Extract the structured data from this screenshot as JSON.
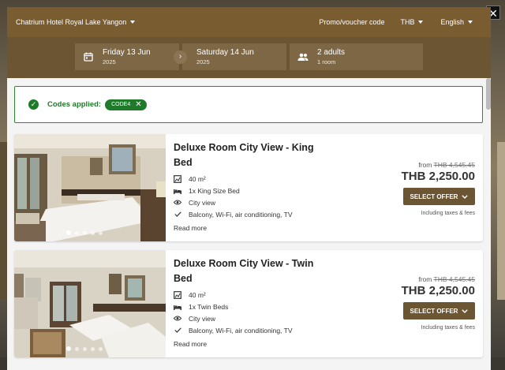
{
  "header": {
    "hotel_name": "Chatrium Hotel Royal Lake Yangon",
    "promo_label": "Promo/voucher code",
    "currency": "THB",
    "language": "English",
    "close_glyph": "✕"
  },
  "search": {
    "checkin_date": "Friday 13 Jun",
    "checkin_year": "2025",
    "checkout_date": "Saturday 14 Jun",
    "checkout_year": "2025",
    "guests": "2 adults",
    "rooms": "1 room"
  },
  "codes": {
    "label": "Codes applied:",
    "code": "CODE4"
  },
  "rooms": [
    {
      "title_line1": "Deluxe Room City View - King",
      "title_line2": "Bed",
      "size": "40 m²",
      "bed": "1x King Size Bed",
      "view": "City view",
      "amenities": "Balcony, Wi-Fi, air conditioning, TV",
      "read_more": "Read more",
      "from_label": "from",
      "old_price": "THB 4,545.45",
      "price": "THB 2,250.00",
      "select_label": "SELECT OFFER",
      "tax_note": "Including taxes & fees"
    },
    {
      "title_line1": "Deluxe Room City View - Twin",
      "title_line2": "Bed",
      "size": "40 m²",
      "bed": "1x Twin Beds",
      "view": "City view",
      "amenities": "Balcony, Wi-Fi, air conditioning, TV",
      "read_more": "Read more",
      "from_label": "from",
      "old_price": "THB 4,545.45",
      "price": "THB 2,250.00",
      "select_label": "SELECT OFFER",
      "tax_note": "Including taxes & fees"
    }
  ],
  "colors": {
    "header_bg": "#7a5c31",
    "search_bg": "#6b5533",
    "success": "#1f7a2a",
    "button_bg": "#6b5533"
  }
}
